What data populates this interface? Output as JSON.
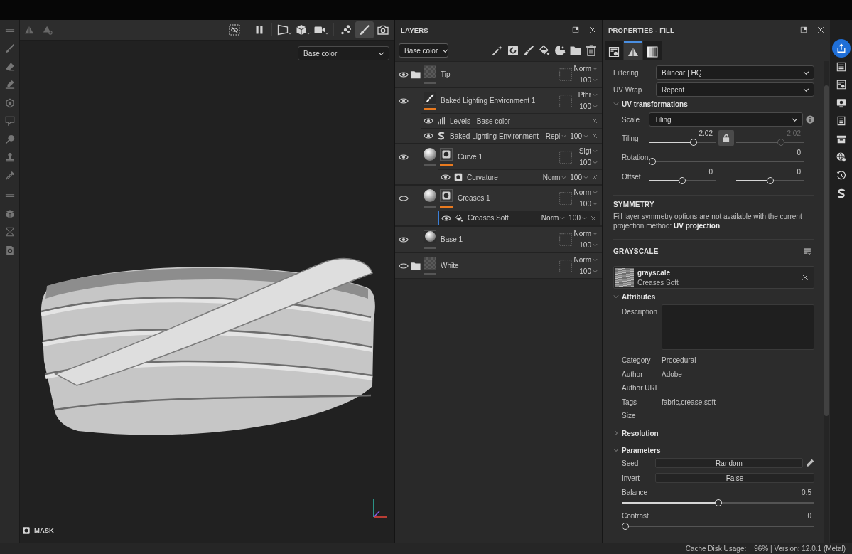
{
  "viewport": {
    "toolbar_groups": [
      [
        {
          "kind": "hide-mesh",
          "selected": false
        }
      ],
      [
        {
          "kind": "pause",
          "selected": false
        }
      ],
      [
        {
          "kind": "view-2d",
          "selected": false
        },
        {
          "kind": "cube",
          "selected": false
        },
        {
          "kind": "camera",
          "selected": false
        }
      ],
      [
        {
          "kind": "particles",
          "selected": false
        },
        {
          "kind": "brush",
          "selected": true
        },
        {
          "kind": "screenshot",
          "selected": false
        }
      ]
    ],
    "channel": "Base color",
    "mask_label": "MASK"
  },
  "layers": {
    "title": "LAYERS",
    "channel": "Base color",
    "items": [
      {
        "kind": "folder",
        "name": "Tip",
        "visible": true,
        "selected": false,
        "blend": "Norm",
        "opacity": "100",
        "content_active": false
      },
      {
        "kind": "paint",
        "name": "Baked Lighting Environment 1",
        "visible": true,
        "selected": false,
        "blend": "Pthr",
        "opacity": "100",
        "content_active": true,
        "effects": [
          {
            "kind": "levels",
            "name": "Levels - Base color",
            "visible": true,
            "selected": false
          },
          {
            "kind": "substance",
            "name": "Baked Lighting Environment",
            "visible": true,
            "selected": false,
            "blend": "Repl",
            "opacity": "100"
          }
        ]
      },
      {
        "kind": "fill",
        "name": "Curve 1",
        "visible": true,
        "selected": false,
        "blend": "Slgt",
        "opacity": "100",
        "content_active": false,
        "mask": {
          "active": true
        },
        "effects": [
          {
            "kind": "generator",
            "name": "Curvature",
            "visible": true,
            "selected": false,
            "blend": "Norm",
            "opacity": "100"
          }
        ]
      },
      {
        "kind": "fill",
        "name": "Creases 1",
        "visible": false,
        "selected": false,
        "blend": "Norm",
        "opacity": "100",
        "content_active": false,
        "mask": {
          "active": true
        },
        "effects": [
          {
            "kind": "fill",
            "name": "Creases Soft",
            "visible": true,
            "selected": true,
            "blend": "Norm",
            "opacity": "100"
          }
        ]
      },
      {
        "kind": "fill",
        "name": "Base 1",
        "visible": true,
        "selected": false,
        "blend": "Norm",
        "opacity": "100",
        "content_active": false
      },
      {
        "kind": "folder",
        "name": "White",
        "visible": false,
        "selected": false,
        "blend": "Norm",
        "opacity": "100",
        "content_active": false
      }
    ]
  },
  "properties": {
    "title": "PROPERTIES - FILL",
    "tabs": [
      {
        "kind": "layer-settings",
        "selected": false
      },
      {
        "kind": "material",
        "selected": true
      },
      {
        "kind": "gradient",
        "selected": false
      }
    ],
    "fields": [
      {
        "label": "Filtering",
        "value": "Bilinear | HQ"
      },
      {
        "label": "UV Wrap",
        "value": "Repeat"
      }
    ],
    "uv_transformations": {
      "title": "UV transformations",
      "expanded": true,
      "scale": {
        "label": "Scale",
        "value": "Tiling"
      },
      "rows": [
        {
          "label": "Tiling",
          "locked": true,
          "sliders": [
            {
              "reading": "2.02",
              "level": 0.69,
              "disabled": false
            },
            {
              "reading": "2.02",
              "level": 0.68,
              "disabled": true
            }
          ]
        },
        {
          "label": "Rotation",
          "sliders": [
            {
              "reading": "0",
              "level": 0,
              "disabled": false
            }
          ]
        },
        {
          "label": "Offset",
          "sliders": [
            {
              "reading": "0",
              "level": 0.5,
              "disabled": false
            },
            {
              "reading": "0",
              "level": 0.5,
              "disabled": false
            }
          ]
        }
      ]
    },
    "symmetry": {
      "title": "SYMMETRY",
      "note": "Fill layer symmetry options are not available with the current projection method: **UV projection**"
    },
    "grayscale": {
      "title": "GRAYSCALE",
      "resource": {
        "name": "grayscale",
        "subtitle": "Creases Soft"
      }
    },
    "attributes": {
      "title": "Attributes",
      "expanded": true,
      "rows": [
        {
          "kind": "textarea",
          "label": "Description"
        },
        {
          "kind": "text",
          "label": "Category",
          "value": "Procedural"
        },
        {
          "kind": "text",
          "label": "Author",
          "value": "Adobe"
        },
        {
          "kind": "text",
          "label": "Author URL"
        },
        {
          "kind": "text",
          "label": "Tags",
          "value": "fabric,crease,soft"
        },
        {
          "kind": "text",
          "label": "Size"
        }
      ]
    },
    "resolution": {
      "title": "Resolution",
      "expanded": false
    },
    "parameters": {
      "title": "Parameters",
      "expanded": true,
      "rows": [
        {
          "kind": "button",
          "label": "Seed",
          "value": "Random",
          "editable": true
        },
        {
          "kind": "button",
          "label": "Invert",
          "value": "False",
          "editable": false
        },
        {
          "kind": "slider",
          "label": "Balance",
          "reading": "0.5",
          "level": 0.5
        },
        {
          "kind": "slider",
          "label": "Contrast",
          "reading": "0",
          "level": 0
        }
      ]
    }
  },
  "right_strip": [
    {
      "kind": "share",
      "selected": true
    },
    {
      "kind": "list",
      "selected": false
    },
    {
      "kind": "panel-gear",
      "selected": false
    },
    {
      "kind": "monitor-gear",
      "selected": false
    },
    {
      "kind": "notepad",
      "selected": false
    },
    {
      "kind": "tray",
      "selected": false
    },
    {
      "kind": "globe",
      "selected": false
    },
    {
      "kind": "history",
      "selected": false
    },
    {
      "kind": "s-logo",
      "selected": false
    }
  ],
  "status_bar": {
    "label": "Cache Disk Usage:",
    "value": "96% | Version: 12.0.1 (Metal)"
  }
}
